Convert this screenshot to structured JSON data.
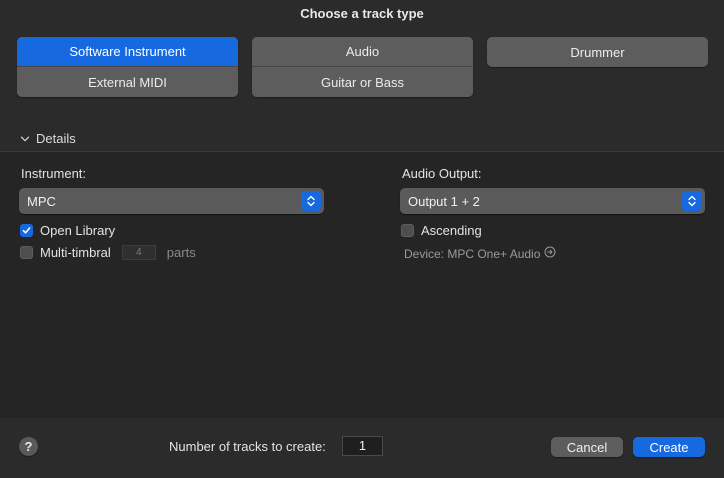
{
  "dialog": {
    "title": "Choose a track type"
  },
  "track_types": {
    "software_instrument": "Software Instrument",
    "external_midi": "External MIDI",
    "audio": "Audio",
    "guitar_or_bass": "Guitar or Bass",
    "drummer": "Drummer",
    "selected": "Software Instrument"
  },
  "details": {
    "toggle_label": "Details",
    "instrument_label": "Instrument:",
    "instrument_value": "MPC",
    "open_library_label": "Open Library",
    "open_library_checked": true,
    "multitimbral_label": "Multi-timbral",
    "multitimbral_checked": false,
    "parts_value": "4",
    "parts_label": "parts",
    "audio_output_label": "Audio Output:",
    "audio_output_value": "Output 1 + 2",
    "ascending_label": "Ascending",
    "ascending_checked": false,
    "device_label": "Device: MPC One+ Audio"
  },
  "footer": {
    "help_symbol": "?",
    "count_label": "Number of tracks to create:",
    "count_value": "1",
    "cancel_label": "Cancel",
    "create_label": "Create"
  },
  "colors": {
    "accent": "#1769e0",
    "background": "#2b2b2b",
    "panel": "#252525",
    "button": "#5d5d5d"
  }
}
